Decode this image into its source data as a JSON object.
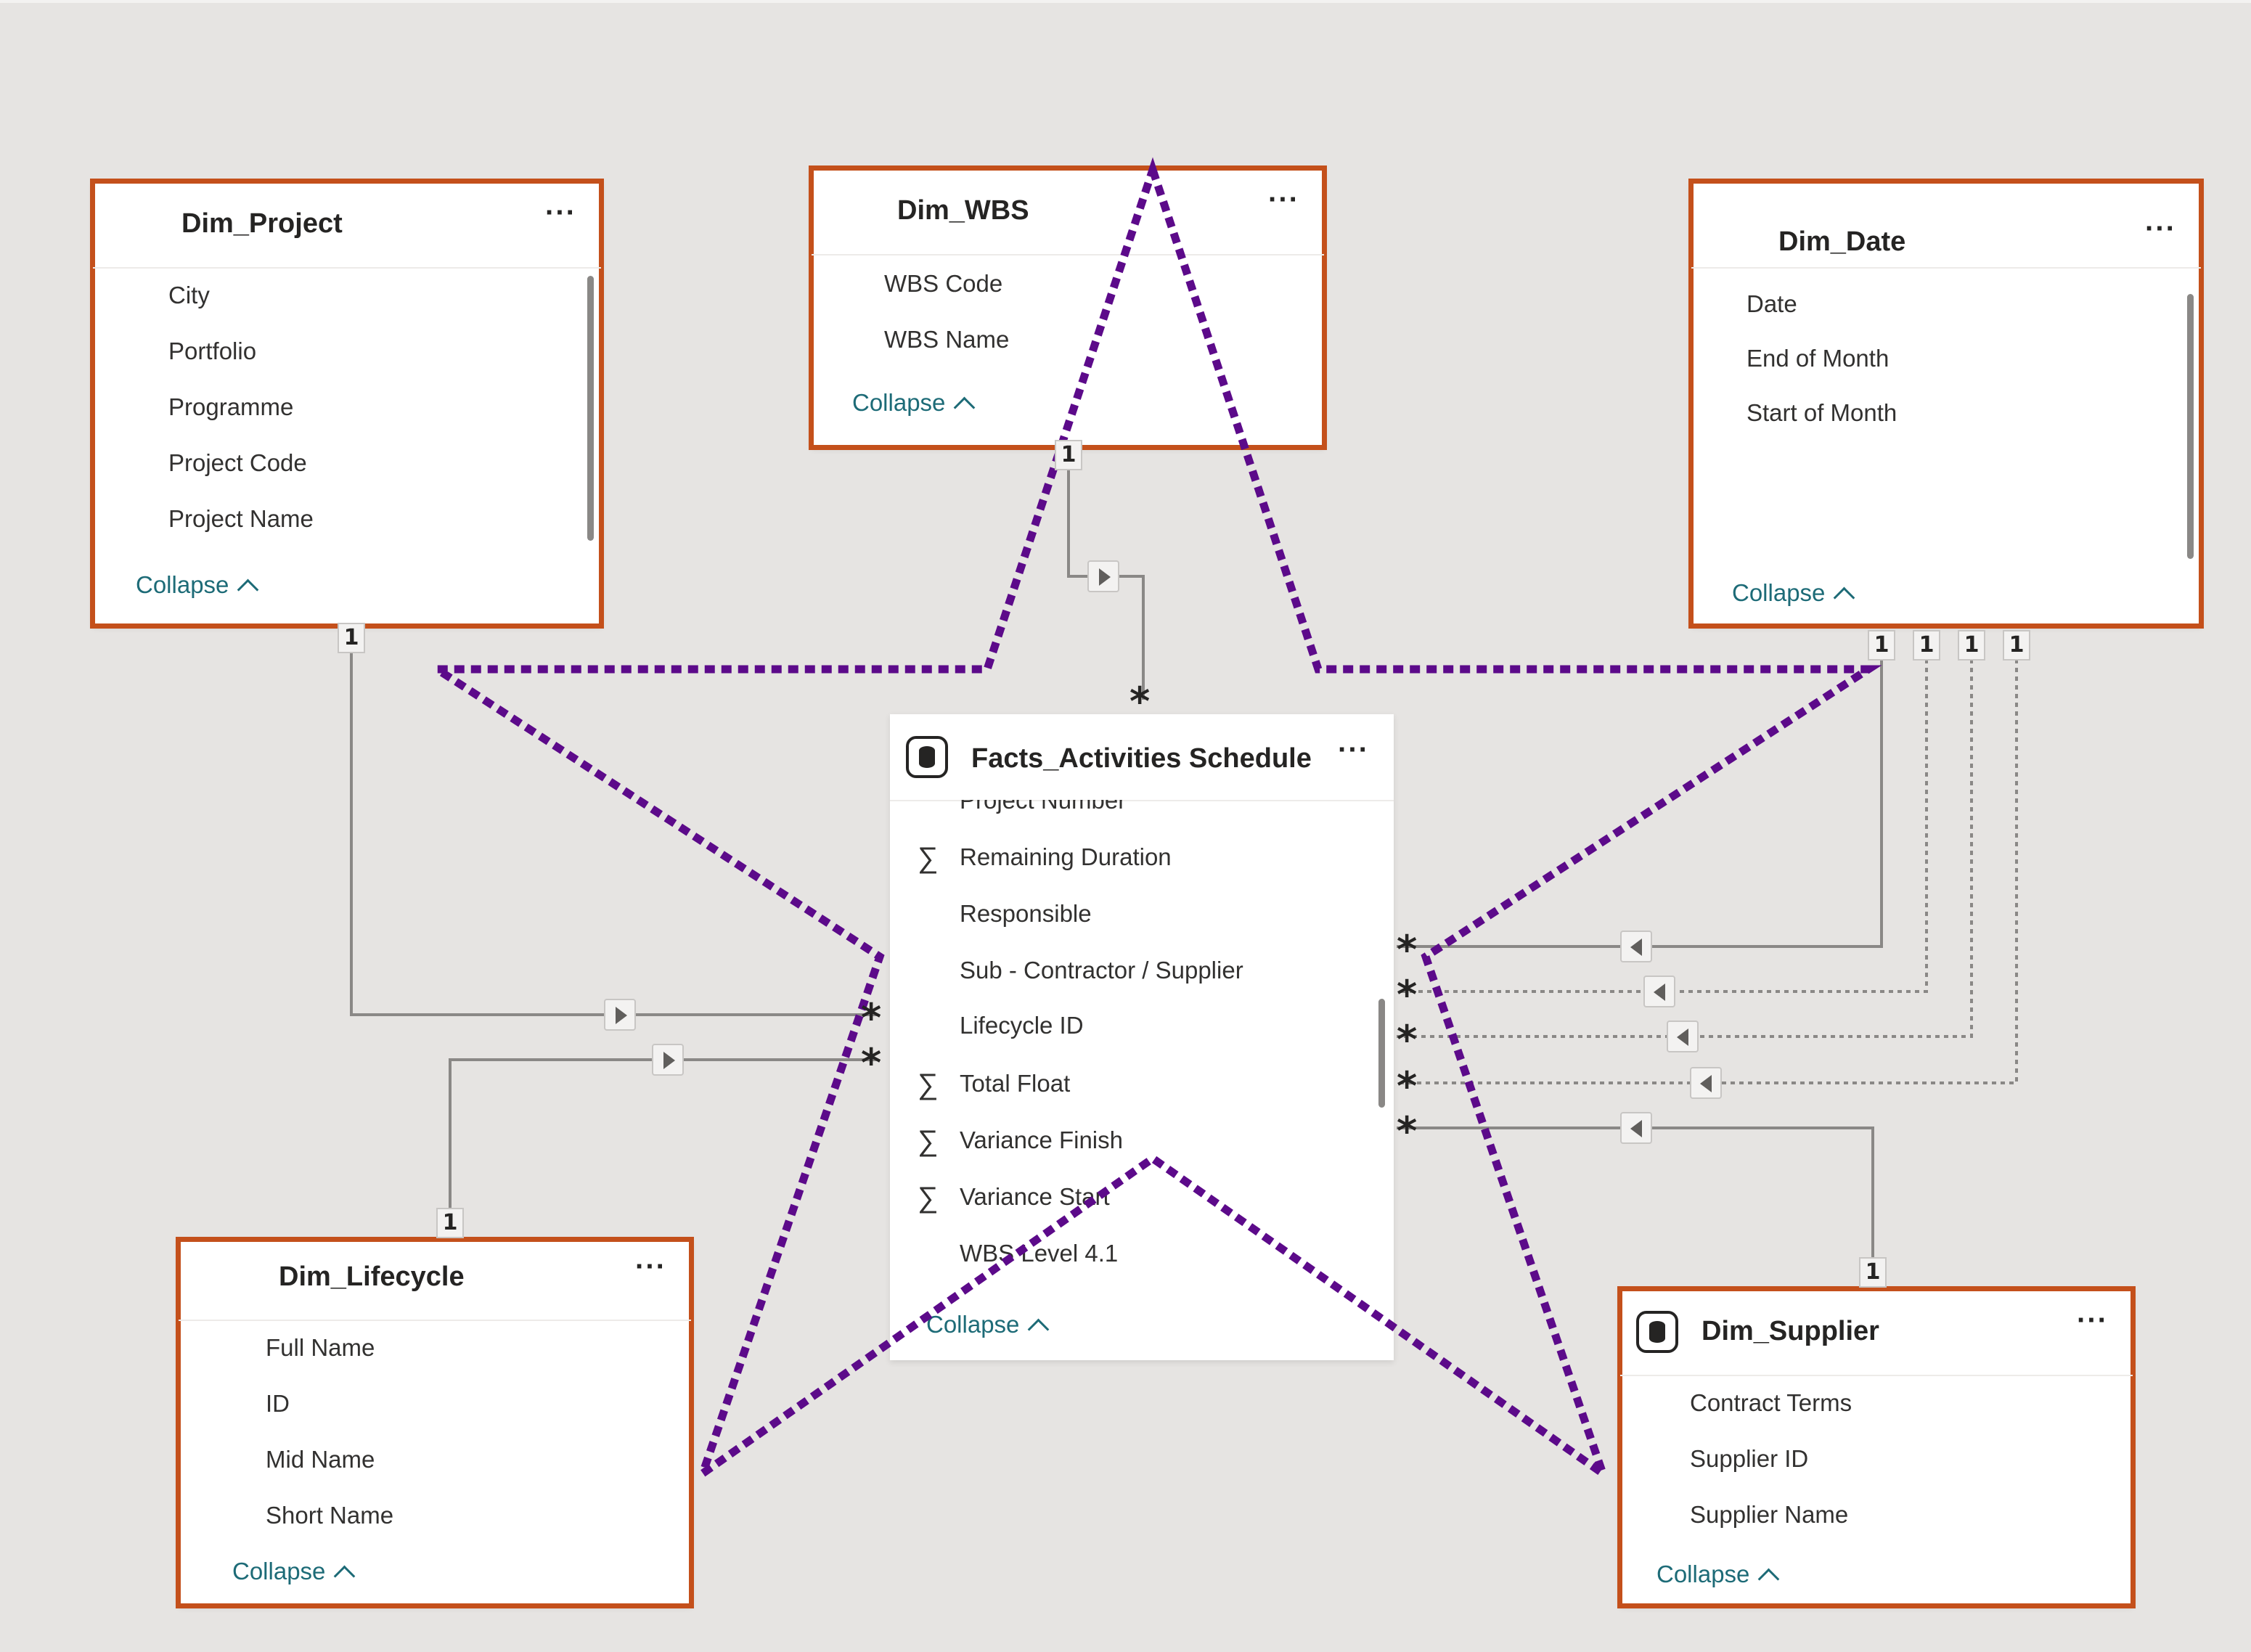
{
  "ui": {
    "more_label": "···",
    "collapse_label": "Collapse"
  },
  "tables": {
    "dim_project": {
      "title": "Dim_Project",
      "fields": [
        "City",
        "Portfolio",
        "Programme",
        "Project Code",
        "Project Name"
      ]
    },
    "dim_wbs": {
      "title": "Dim_WBS",
      "fields": [
        "WBS Code",
        "WBS Name"
      ]
    },
    "dim_date": {
      "title": "Dim_Date",
      "fields": [
        "Date",
        "End of Month",
        "Start of Month"
      ]
    },
    "facts": {
      "title": "Facts_Activities Schedule",
      "fields": [
        {
          "label": "Project Number",
          "sigma": false
        },
        {
          "label": "Remaining Duration",
          "sigma": true
        },
        {
          "label": "Responsible",
          "sigma": false
        },
        {
          "label": "Sub - Contractor / Supplier",
          "sigma": false
        },
        {
          "label": "Lifecycle ID",
          "sigma": false
        },
        {
          "label": "Total Float",
          "sigma": true
        },
        {
          "label": "Variance Finish",
          "sigma": true
        },
        {
          "label": "Variance Start",
          "sigma": true
        },
        {
          "label": "WBS Level 4.1",
          "sigma": false
        }
      ]
    },
    "dim_lifecycle": {
      "title": "Dim_Lifecycle",
      "fields": [
        "Full Name",
        "ID",
        "Mid Name",
        "Short Name"
      ]
    },
    "dim_supplier": {
      "title": "Dim_Supplier",
      "fields": [
        "Contract Terms",
        "Supplier ID",
        "Supplier Name"
      ]
    }
  },
  "relationships": {
    "one_label": "1",
    "many_label": "*",
    "items": [
      {
        "from": "Dim_Project",
        "to": "Facts_Activities Schedule",
        "cardinality": "1:*",
        "style": "active"
      },
      {
        "from": "Dim_WBS",
        "to": "Facts_Activities Schedule",
        "cardinality": "1:*",
        "style": "active"
      },
      {
        "from": "Dim_Date",
        "to": "Facts_Activities Schedule",
        "cardinality": "1:*",
        "style": "active"
      },
      {
        "from": "Dim_Date",
        "to": "Facts_Activities Schedule",
        "cardinality": "1:*",
        "style": "inactive"
      },
      {
        "from": "Dim_Date",
        "to": "Facts_Activities Schedule",
        "cardinality": "1:*",
        "style": "inactive"
      },
      {
        "from": "Dim_Date",
        "to": "Facts_Activities Schedule",
        "cardinality": "1:*",
        "style": "inactive"
      },
      {
        "from": "Dim_Lifecycle",
        "to": "Facts_Activities Schedule",
        "cardinality": "1:*",
        "style": "active"
      },
      {
        "from": "Dim_Supplier",
        "to": "Facts_Activities Schedule",
        "cardinality": "1:*",
        "style": "active"
      }
    ]
  },
  "colors": {
    "canvas": "#e6e4e2",
    "highlight_border": "#c4501b",
    "star_overlay": "#5c0a8a",
    "line": "#8a8886",
    "collapse_link": "#1d6b77"
  }
}
